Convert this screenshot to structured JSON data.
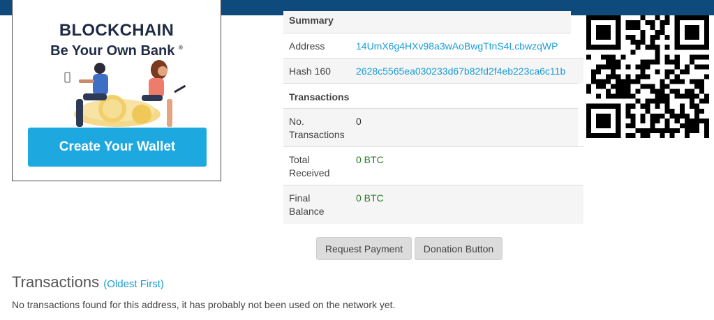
{
  "ad": {
    "brand": "BLOCKCHAIN",
    "tagline": "Be Your Own Bank",
    "registered": "®",
    "cta": "Create Your Wallet"
  },
  "summary": {
    "header": "Summary",
    "address_label": "Address",
    "address_value": "14UmX6g4HXv98a3wAoBwgTtnS4LcbwzqWP",
    "hash_label": "Hash 160",
    "hash_value": "2628c5565ea030233d67b82fd2f4eb223ca6c11b"
  },
  "transactions_table": {
    "header": "Transactions",
    "no_tx_label_1": "No.",
    "no_tx_label_2": "Transactions",
    "no_tx_value": "0",
    "received_label_1": "Total",
    "received_label_2": "Received",
    "received_value": "0 BTC",
    "balance_label_1": "Final",
    "balance_label_2": "Balance",
    "balance_value": "0 BTC"
  },
  "actions": {
    "request_payment": "Request Payment",
    "donation_button": "Donation Button"
  },
  "transactions_section": {
    "title": "Transactions",
    "order_link": "(Oldest First)",
    "empty_message": "No transactions found for this address, it has probably not been used on the network yet."
  },
  "colors": {
    "topbar": "#0f4a7c",
    "link": "#1a9cd6",
    "btc_amount": "#2a7a2a",
    "cta_button": "#1ea8e0"
  },
  "icons": [
    "qr-code-icon",
    "blockchain-ad-illustration"
  ]
}
